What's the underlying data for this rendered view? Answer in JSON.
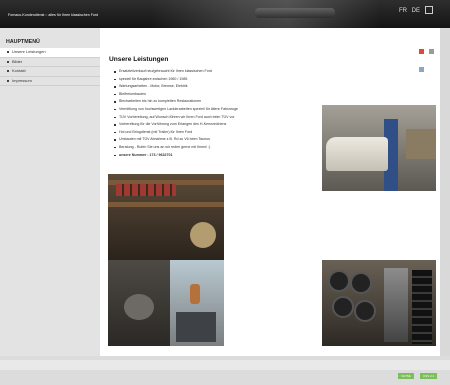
{
  "header": {
    "site_title": "Fornaco-Kundendienst :: alles für Ihren klassischen Ford",
    "lang": [
      "FR",
      "DE"
    ]
  },
  "sidebar": {
    "title": "HAUPTMENÜ",
    "items": [
      {
        "label": "Unsere Leistungen",
        "active": true
      },
      {
        "label": "Bilder"
      },
      {
        "label": "Kontakt"
      },
      {
        "label": "Impressum"
      }
    ]
  },
  "content": {
    "title": "Unsere Leistungen",
    "services": [
      "Ersatzteilverkauf neu/gebraucht für Ihren klassischen Ford",
      "speziell für Baujahre zwischen 1960 / 1985",
      "Wartungsarbeiten - Motor, Bremse, Elektrik",
      "Bleifreiumbauten",
      "Blecharbeiten bis hin zu kompletten Restaurationen",
      "Vermittlung von hochwertigen Lackierarbeiten speziell für ältere Fahrzeuge",
      "TÜV Vorbereitung, auf Wunsch führen wir Ihren Ford auch beim TÜV vor",
      "Vorbereitung für die Vorführung zum Erlangen des H-Kennzeichens",
      "Hol und Bringdienst (mit Trailer) für Ihren Ford",
      "Umbauten mit TÜV Abnahme z.B. Rd zu V6 beim Taunus",
      "Beratung - Rufen Sie uns an wir reden gerne mit Ihnen! :)",
      "unsere Nummer : 173 / 9632701"
    ]
  },
  "footer": {
    "buttons": [
      "XHTML",
      "CSS 2.1"
    ]
  },
  "colors": {
    "header_bg": "#1e1e1e",
    "accent_green": "#7bbf5b",
    "sidebar_bg": "#e3e3e3"
  }
}
